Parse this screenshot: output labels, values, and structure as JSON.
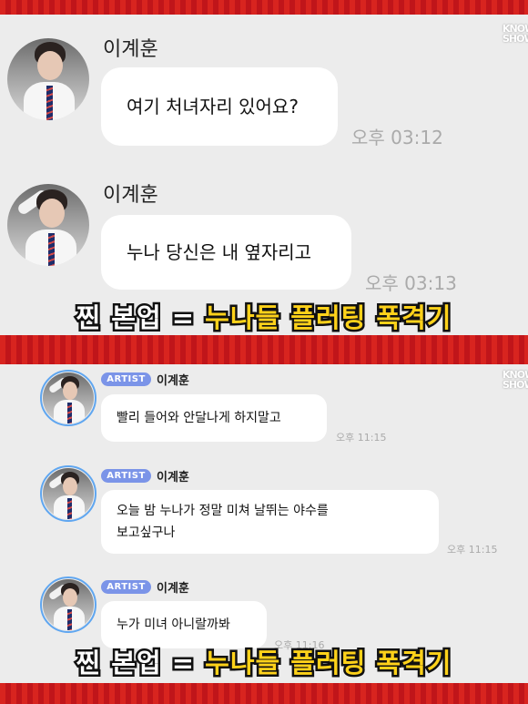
{
  "watermark": "KNOWING SHOW",
  "top_section": {
    "messages": [
      {
        "sender": "이계훈",
        "text": "여기 처녀자리 있어요?",
        "time": "오후 03:12"
      },
      {
        "sender": "이계훈",
        "text": "누나 당신은 내 옆자리고",
        "time": "오후 03:13"
      }
    ],
    "caption_white": "찐 본업 = ",
    "caption_yellow": "누나들 플러팅 폭격기"
  },
  "bottom_section": {
    "messages": [
      {
        "badge": "ARTIST",
        "sender": "이계훈",
        "lines": [
          "빨리 들어와 안달나게 하지말고"
        ],
        "time": "오후 11:15"
      },
      {
        "badge": "ARTIST",
        "sender": "이계훈",
        "lines": [
          "오늘 밤 누나가 정말 미쳐 날뛰는 야수를",
          "보고싶구나"
        ],
        "time": "오후 11:15"
      },
      {
        "badge": "ARTIST",
        "sender": "이계훈",
        "lines": [
          "누가 미녀 아니랄까봐"
        ],
        "time": "오후 11:16"
      }
    ],
    "caption_white": "찐 본업 = ",
    "caption_yellow": "누나들 플러팅 폭격기"
  }
}
